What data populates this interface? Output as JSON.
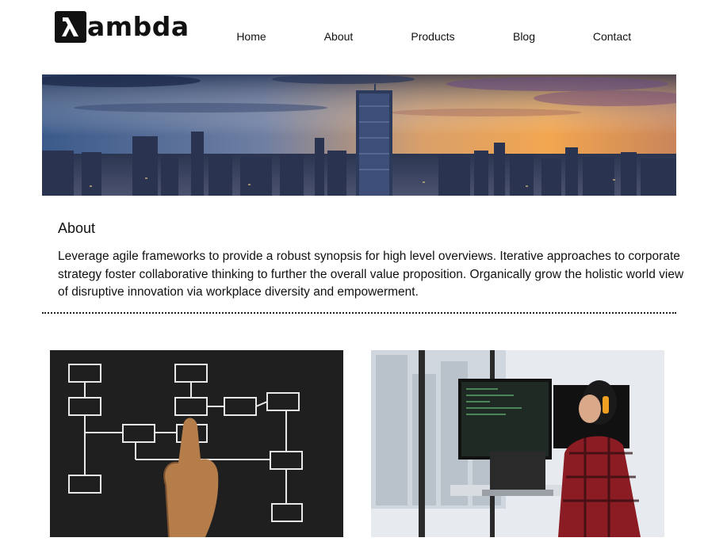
{
  "brand": {
    "logo_text": "ambda"
  },
  "nav": {
    "items": [
      "Home",
      "About",
      "Products",
      "Blog",
      "Contact"
    ]
  },
  "about": {
    "title": "About",
    "body": "Leverage agile frameworks to provide a robust synopsis for high level overviews. Iterative approaches to corporate strategy foster collaborative thinking to further the overall value proposition. Organically grow the holistic world view of disruptive innovation via workplace diversity and empowerment."
  },
  "colors": {
    "text": "#111111",
    "background": "#ffffff"
  }
}
